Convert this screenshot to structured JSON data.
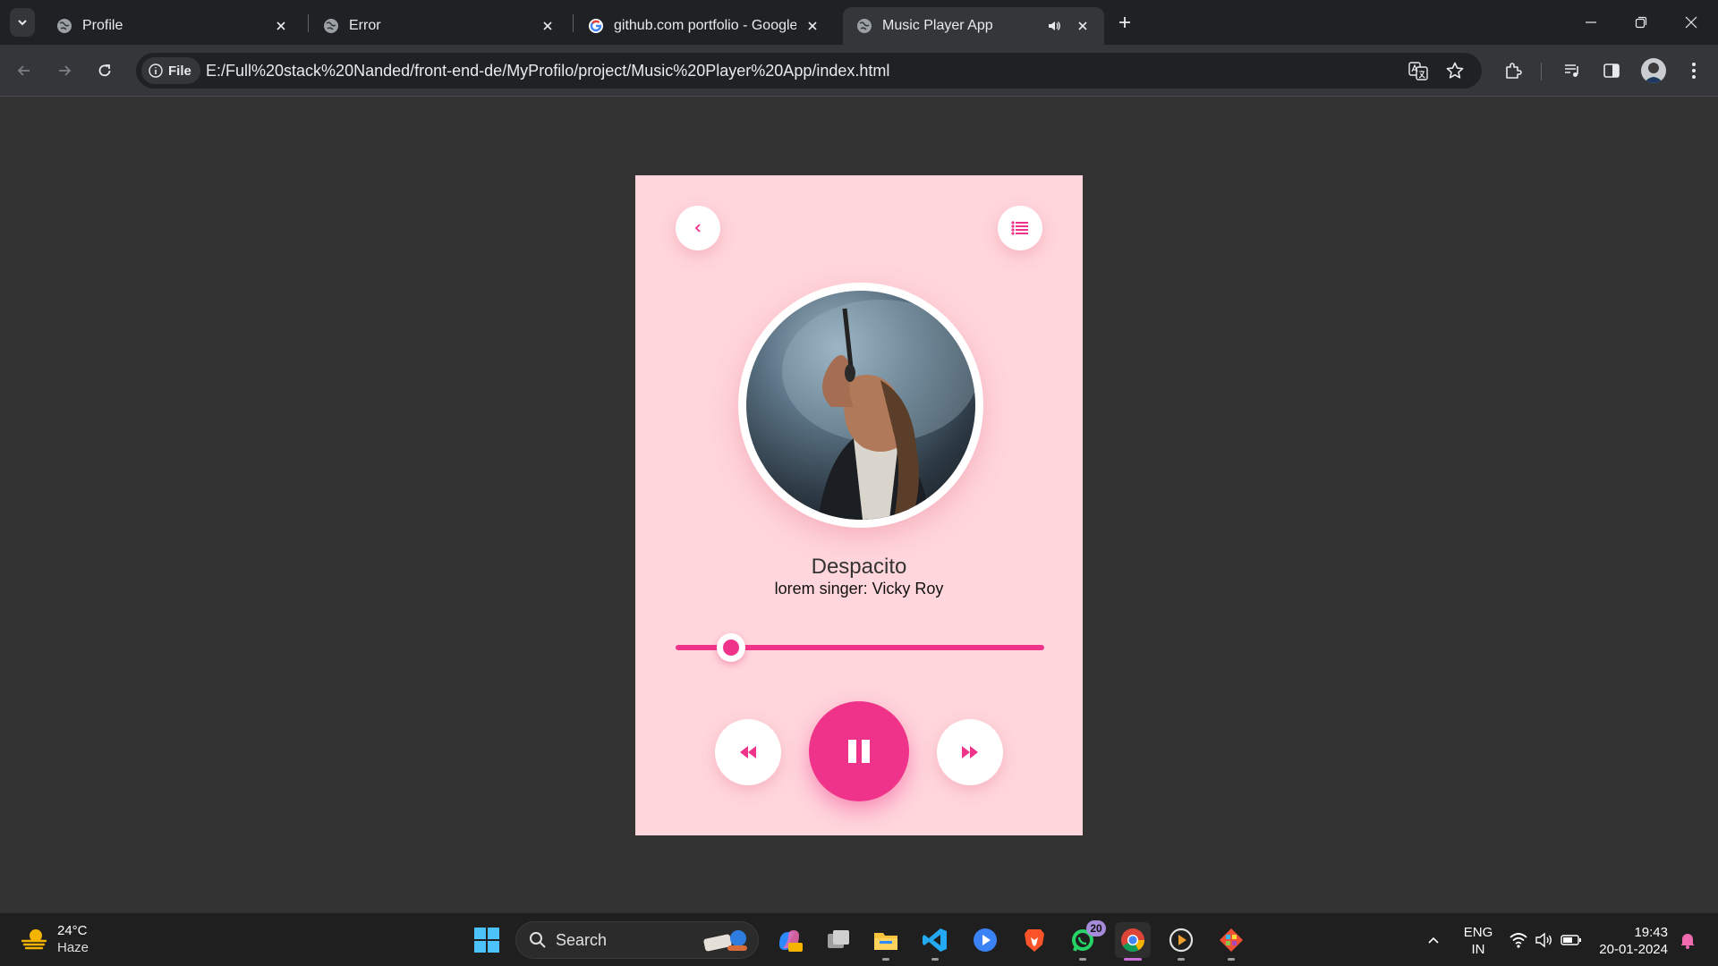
{
  "browser": {
    "tabs": [
      {
        "title": "Profile",
        "favicon": "globe-icon",
        "active": false
      },
      {
        "title": "Error",
        "favicon": "globe-icon",
        "active": false
      },
      {
        "title": "github.com portfolio - Google S",
        "favicon": "google-icon",
        "active": false
      },
      {
        "title": "Music Player App",
        "favicon": "globe-icon",
        "active": true,
        "audio": true
      }
    ],
    "address": {
      "chip_label": "File",
      "url": "E:/Full%20stack%20Nanded/front-end-de/MyProfilo/project/Music%20Player%20App/index.html"
    }
  },
  "player": {
    "song_title": "Despacito",
    "artist_line": "lorem singer: Vicky Roy",
    "progress": 0.15,
    "state": "playing",
    "accent": "#f0338a",
    "card_bg": "#ffd6dc",
    "icons": {
      "back": "chevron-left-icon",
      "menu": "list-icon",
      "prev": "rewind-icon",
      "play": "pause-icon",
      "next": "fast-forward-icon"
    }
  },
  "taskbar": {
    "weather": {
      "temp": "24°C",
      "condition": "Haze"
    },
    "search_label": "Search",
    "whatsapp_badge": "20",
    "language": {
      "line1": "ENG",
      "line2": "IN"
    },
    "clock": {
      "time": "19:43",
      "date": "20-01-2024"
    }
  }
}
